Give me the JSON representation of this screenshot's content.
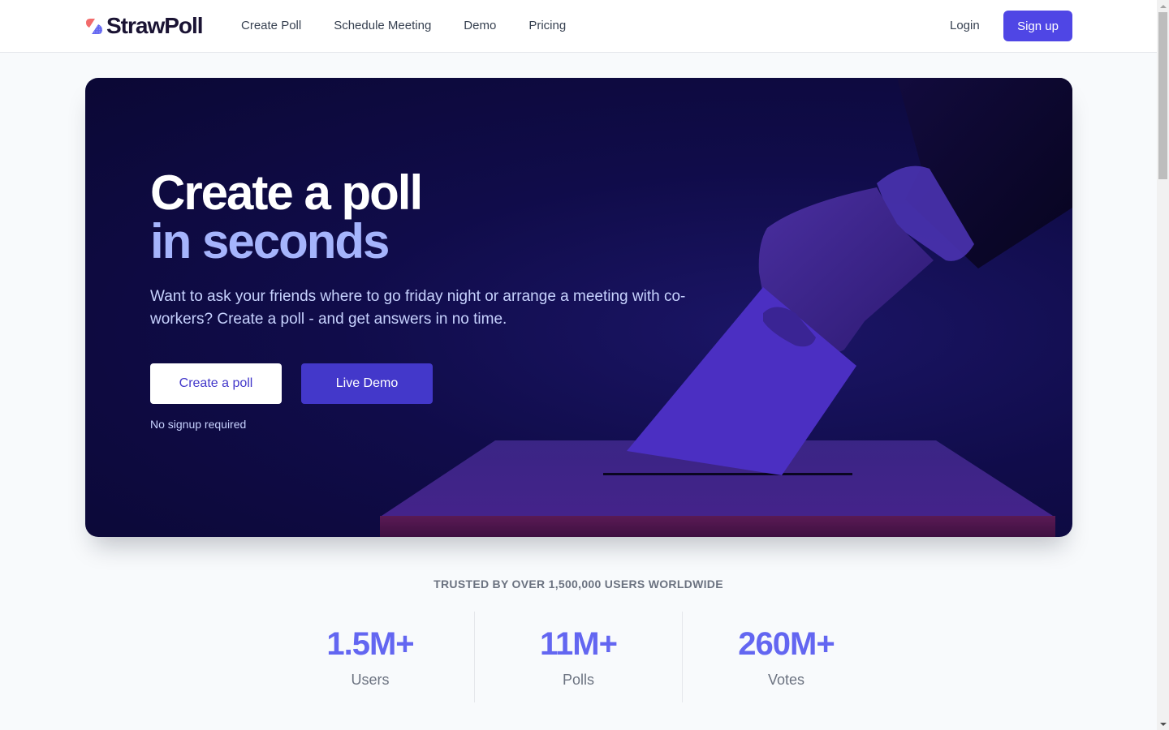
{
  "header": {
    "logo_text": "StrawPoll",
    "nav": [
      {
        "label": "Create Poll"
      },
      {
        "label": "Schedule Meeting"
      },
      {
        "label": "Demo"
      },
      {
        "label": "Pricing"
      }
    ],
    "login_label": "Login",
    "signup_label": "Sign up"
  },
  "hero": {
    "title_line1": "Create a poll",
    "title_line2": "in seconds",
    "subtitle": "Want to ask your friends where to go friday night or arrange a meeting with co-workers? Create a poll - and get answers in no time.",
    "primary_button": "Create a poll",
    "secondary_button": "Live Demo",
    "note": "No signup required",
    "image_description": "hand-dropping-ballot-into-box"
  },
  "stats": {
    "heading": "TRUSTED BY OVER 1,500,000 USERS WORLDWIDE",
    "items": [
      {
        "value": "1.5M+",
        "label": "Users"
      },
      {
        "value": "11M+",
        "label": "Polls"
      },
      {
        "value": "260M+",
        "label": "Votes"
      }
    ]
  },
  "colors": {
    "brand_primary": "#4f46e5",
    "hero_background": "#100c4a",
    "hero_accent_text": "#a5b4fc",
    "stat_value": "#6366f1",
    "logo_red": "#f26b6b",
    "logo_blue": "#6366f1"
  }
}
